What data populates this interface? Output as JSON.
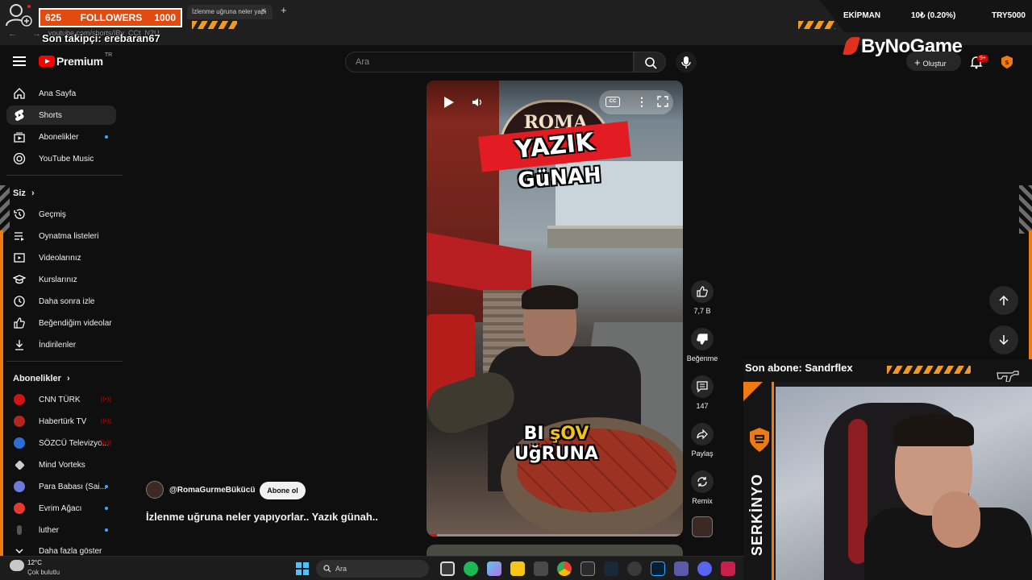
{
  "browser": {
    "tab_title": "İzlenme uğruna neler yapı",
    "tab_close": "×",
    "tab_new": "+",
    "url": "youtube.com/shorts/IBy_CCt_N2U"
  },
  "stream_overlay": {
    "followers_current": "625",
    "followers_label": "FOLLOWERS",
    "followers_goal": "1000",
    "last_follower": "Son takipçi: erebaran67",
    "ticker_label_1": "EKİPMAN",
    "ticker_value_1": "10₺ (0.20%)",
    "ticker_label_2": "TRY5000",
    "brand": "ByNoGame",
    "last_sub": "Son abone: Sandrflex",
    "streamer_name": "SERKİNYO"
  },
  "header": {
    "logo_text": "Premium",
    "logo_country": "TR",
    "search_placeholder": "Ara",
    "create_label": "Oluştur",
    "notif_badge": "9+"
  },
  "sidebar": {
    "main": [
      {
        "label": "Ana Sayfa",
        "icon": "home-icon"
      },
      {
        "label": "Shorts",
        "icon": "shorts-icon",
        "active": true
      },
      {
        "label": "Abonelikler",
        "icon": "subscriptions-icon",
        "dot": true
      },
      {
        "label": "YouTube Music",
        "icon": "youtube-music-icon"
      }
    ],
    "you_header": "Siz",
    "you": [
      {
        "label": "Geçmiş",
        "icon": "history-icon"
      },
      {
        "label": "Oynatma listeleri",
        "icon": "playlists-icon"
      },
      {
        "label": "Videolarınız",
        "icon": "your-videos-icon"
      },
      {
        "label": "Kurslarınız",
        "icon": "courses-icon"
      },
      {
        "label": "Daha sonra izle",
        "icon": "watch-later-icon"
      },
      {
        "label": "Beğendiğim videolar",
        "icon": "liked-videos-icon"
      },
      {
        "label": "İndirilenler",
        "icon": "downloads-icon"
      }
    ],
    "subs_header": "Abonelikler",
    "subs": [
      {
        "label": "CNN TÜRK",
        "color": "#d01414",
        "live": true
      },
      {
        "label": "Habertürk TV",
        "color": "#b3261e",
        "live": true
      },
      {
        "label": "SÖZCÜ Televizyo...",
        "color": "#2b6fd6",
        "live": true
      },
      {
        "label": "Mind Vorteks",
        "color": "#cccccc",
        "dot": true
      },
      {
        "label": "Para Babası (Sai...",
        "color": "#6a7bd8",
        "dot": true
      },
      {
        "label": "Evrim Ağacı",
        "color": "#e23b2e",
        "dot": true
      },
      {
        "label": "luther",
        "color": "#555555",
        "dot": true
      }
    ],
    "show_more": "Daha fazla göster"
  },
  "short": {
    "sign_text": "ROMA",
    "caption_top_1": "YAZIK",
    "caption_top_2": "GüNAH",
    "caption_bottom_prefix": "BI ",
    "caption_bottom_highlight": "şOV",
    "caption_bottom_suffix": " UğRUNA",
    "progress_percent": 4,
    "channel": "@RomaGurmeBükücü",
    "subscribe_label": "Abone ol",
    "title": "İzlenme uğruna neler yapıyorlar.. Yazık günah..",
    "likes": "7,7 B",
    "dislike_label": "Beğenme",
    "comments": "147",
    "share_label": "Paylaş",
    "remix_label": "Remix"
  },
  "taskbar": {
    "temp": "12°C",
    "weather": "Çok bulutlu",
    "search_placeholder": "Ara"
  },
  "colors": {
    "accent_orange": "#f07a12",
    "yt_red": "#ff0000",
    "background": "#0f0f0f"
  }
}
